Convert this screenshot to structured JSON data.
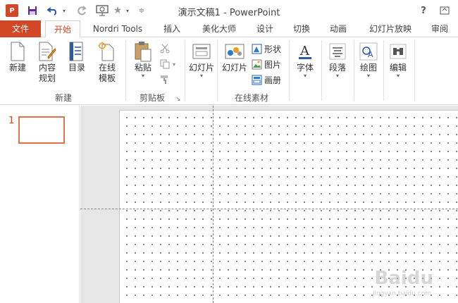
{
  "titlebar": {
    "window_title": "演示文稿1 - PowerPoint",
    "app_logo_text": "P",
    "help_label": "?",
    "icons": [
      "save-icon",
      "undo-icon",
      "redo-icon",
      "presentation-icon",
      "star-icon",
      "customize-icon"
    ]
  },
  "tabs": {
    "file": "文件",
    "home": "开始",
    "nordri": "Nordri Tools",
    "insert": "插入",
    "beautify": "美化大师",
    "design": "设计",
    "transitions": "切换",
    "animations": "动画",
    "slideshow": "幻灯片放映",
    "review": "审阅"
  },
  "ribbon": {
    "new_group": {
      "label": "新建",
      "new_btn": "新建",
      "content_plan_line1": "内容",
      "content_plan_line2": "规划",
      "toc_btn": "目录",
      "online_template_line1": "在线",
      "online_template_line2": "模板"
    },
    "clipboard_group": {
      "label": "剪贴板",
      "paste_btn": "粘贴"
    },
    "slides_btn": "幻灯片",
    "online_group": {
      "label": "在线素材",
      "slides_btn": "幻灯片",
      "shapes": "形状",
      "pictures": "图片",
      "albums": "画册"
    },
    "font_btn": "字体",
    "paragraph_btn": "段落",
    "drawing_btn": "绘图",
    "editing_btn": "编辑"
  },
  "thumbs": {
    "slide_number": "1"
  },
  "watermark": {
    "brand": "Baidu",
    "sub": "jingyan.baidu.com"
  },
  "colors": {
    "accent": "#d24726",
    "thumb_border": "#e0714a"
  }
}
